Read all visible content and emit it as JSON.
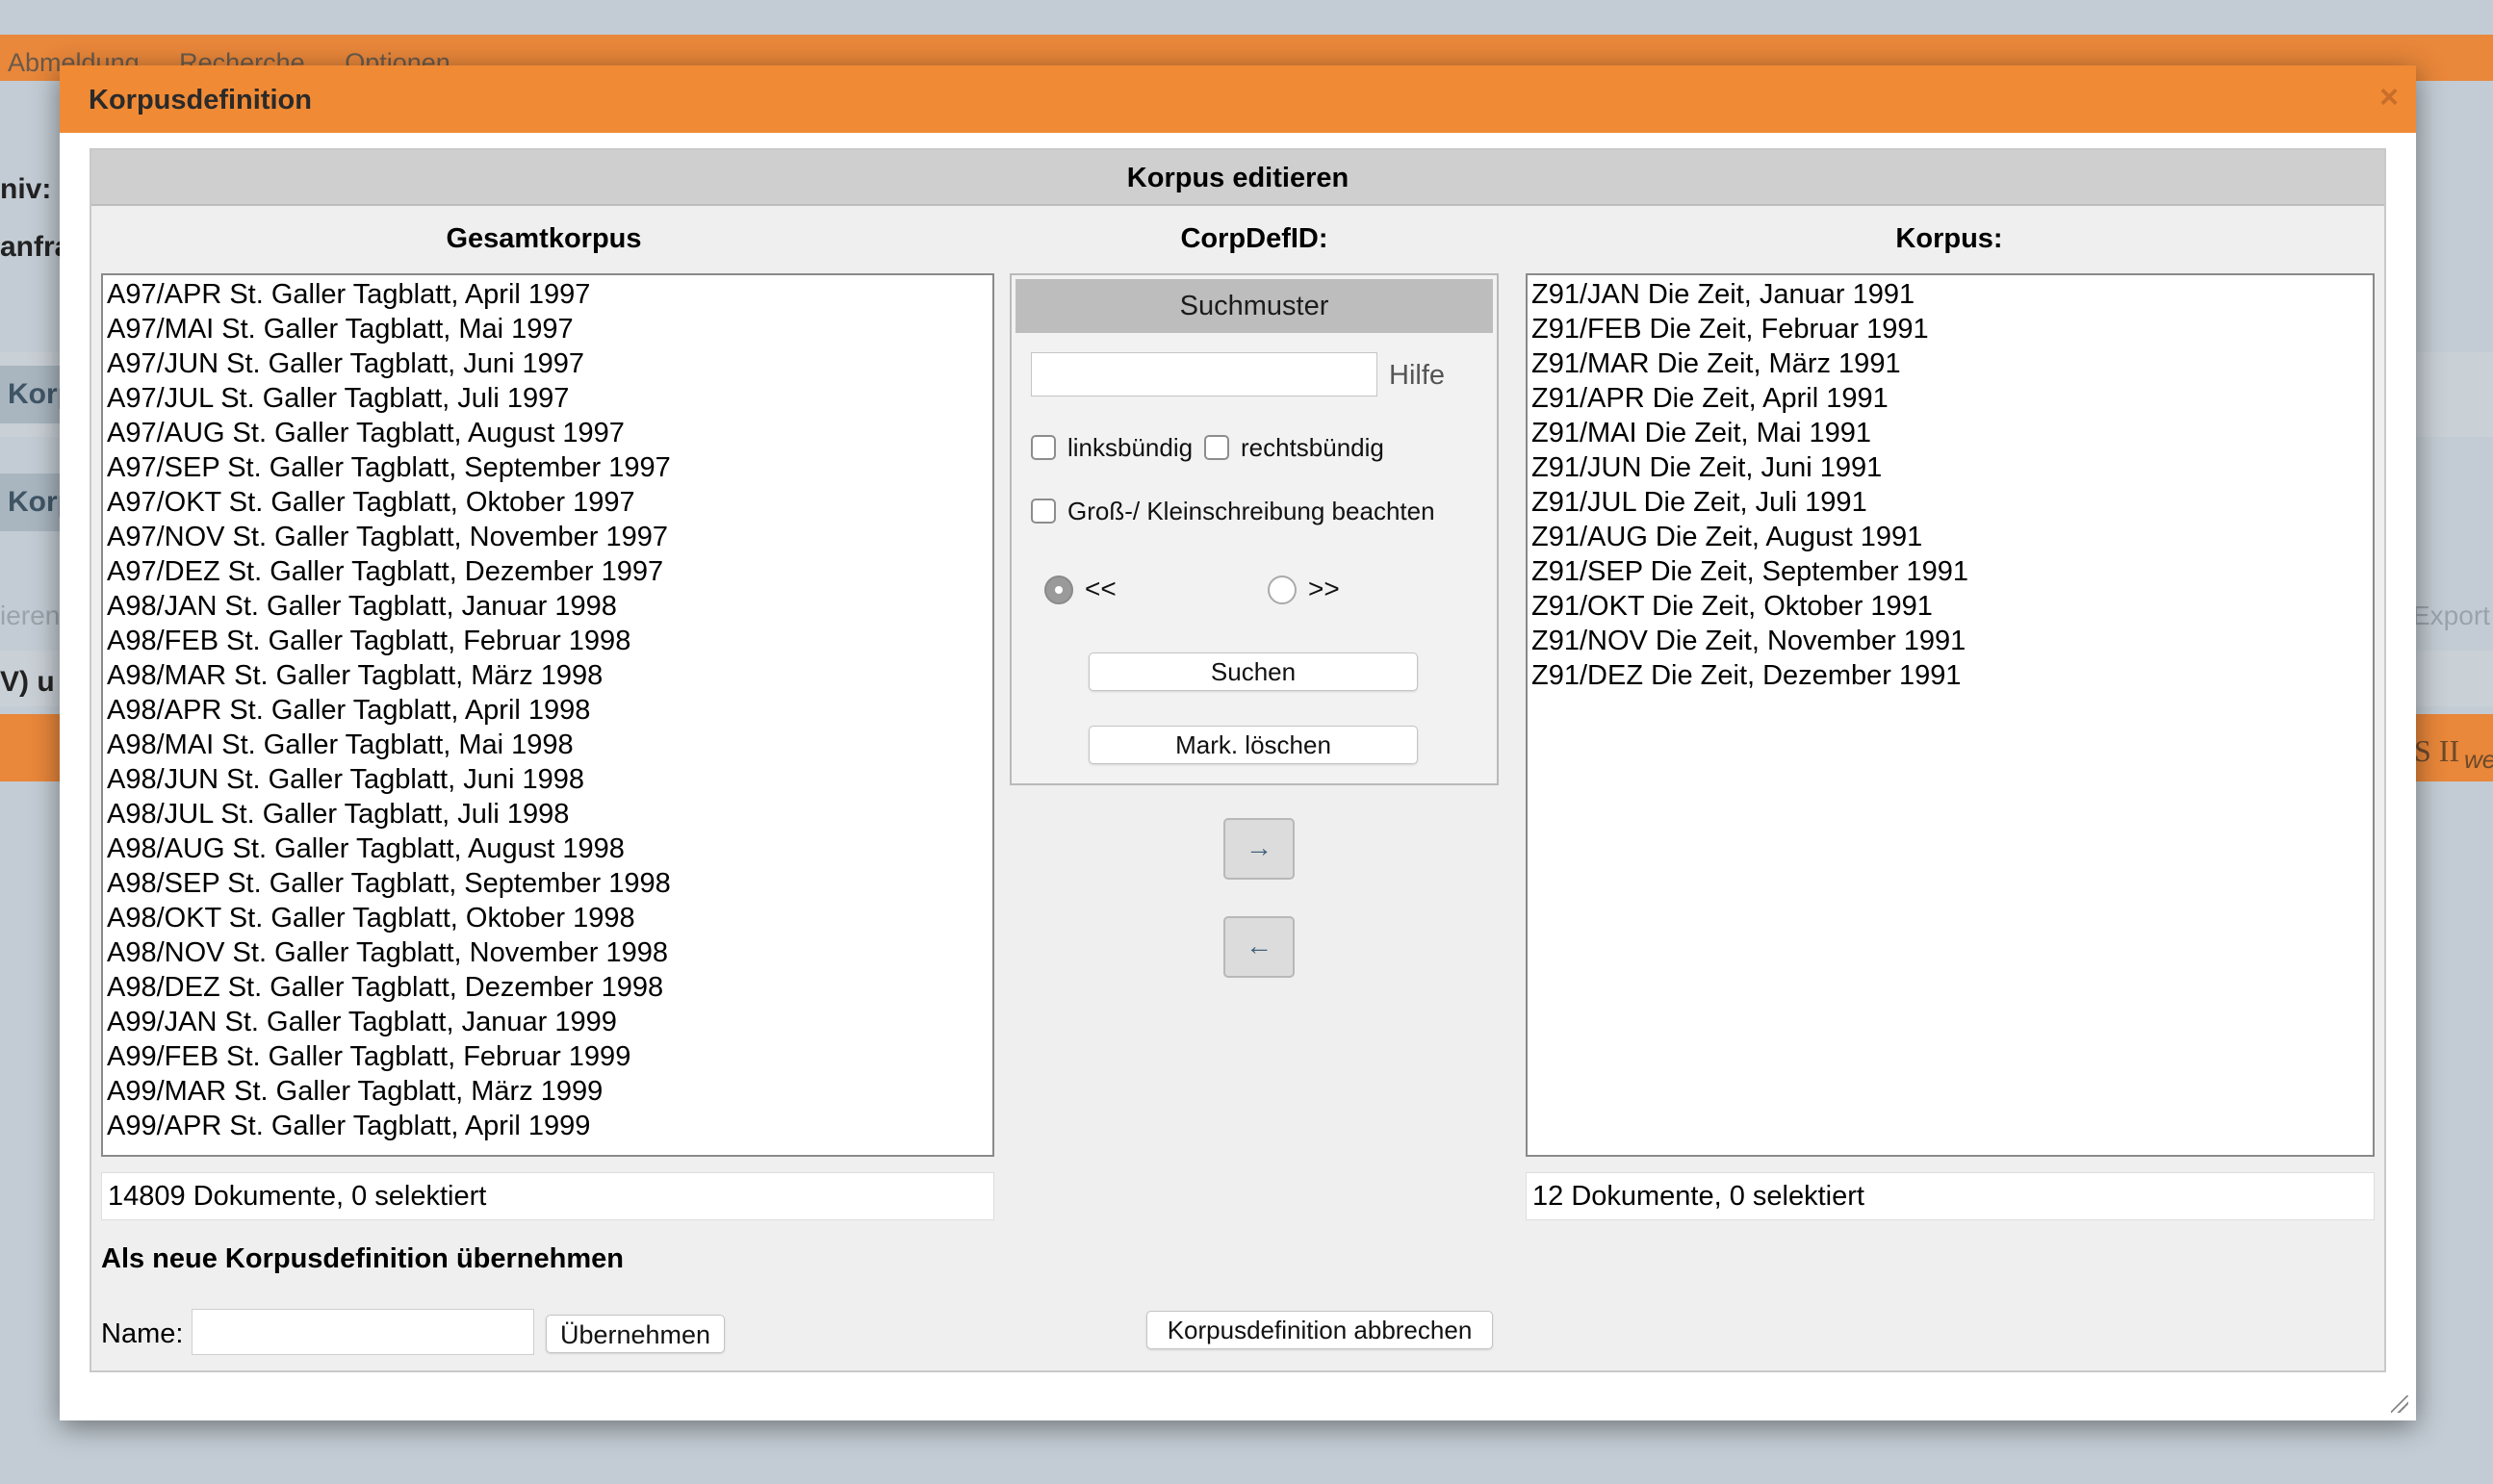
{
  "background": {
    "nav": [
      "Abmeldung",
      "Recherche",
      "Optionen"
    ],
    "labels": {
      "archiv": "niv:",
      "anfrage": "anfra",
      "korp_tab1": "Korp",
      "korp_tab2": "Korp",
      "ieren": "ieren",
      "v_und": "V) u",
      "export": "Export",
      "cosmas": "S II",
      "we": "we"
    }
  },
  "modal": {
    "title": "Korpusdefinition",
    "close": "×",
    "panel_title": "Korpus editieren",
    "left": {
      "title": "Gesamtkorpus",
      "items": [
        "A97/APR St. Galler Tagblatt, April 1997",
        "A97/MAI St. Galler Tagblatt, Mai 1997",
        "A97/JUN St. Galler Tagblatt, Juni 1997",
        "A97/JUL St. Galler Tagblatt, Juli 1997",
        "A97/AUG St. Galler Tagblatt, August 1997",
        "A97/SEP St. Galler Tagblatt, September 1997",
        "A97/OKT St. Galler Tagblatt, Oktober 1997",
        "A97/NOV St. Galler Tagblatt, November 1997",
        "A97/DEZ St. Galler Tagblatt, Dezember 1997",
        "A98/JAN St. Galler Tagblatt, Januar 1998",
        "A98/FEB St. Galler Tagblatt, Februar 1998",
        "A98/MAR St. Galler Tagblatt, März 1998",
        "A98/APR St. Galler Tagblatt, April 1998",
        "A98/MAI St. Galler Tagblatt, Mai 1998",
        "A98/JUN St. Galler Tagblatt, Juni 1998",
        "A98/JUL St. Galler Tagblatt, Juli 1998",
        "A98/AUG St. Galler Tagblatt, August 1998",
        "A98/SEP St. Galler Tagblatt, September 1998",
        "A98/OKT St. Galler Tagblatt, Oktober 1998",
        "A98/NOV St. Galler Tagblatt, November 1998",
        "A98/DEZ St. Galler Tagblatt, Dezember 1998",
        "A99/JAN St. Galler Tagblatt, Januar 1999",
        "A99/FEB St. Galler Tagblatt, Februar 1999",
        "A99/MAR St. Galler Tagblatt, März 1999",
        "A99/APR St. Galler Tagblatt, April 1999"
      ],
      "count": "14809 Dokumente, 0 selektiert"
    },
    "middle": {
      "title": "CorpDefID:",
      "search_header": "Suchmuster",
      "search_value": "",
      "help": "Hilfe",
      "left_aligned": "linksbündig",
      "right_aligned": "rechtsbündig",
      "case_sensitive": "Groß-/ Kleinschreibung beachten",
      "dir_left": "<<",
      "dir_right": ">>",
      "search_button": "Suchen",
      "clear_button": "Mark. löschen",
      "move_right": "→",
      "move_left": "←"
    },
    "right": {
      "title": "Korpus:",
      "items": [
        "Z91/JAN Die Zeit, Januar 1991",
        "Z91/FEB Die Zeit, Februar 1991",
        "Z91/MAR Die Zeit, März 1991",
        "Z91/APR Die Zeit, April 1991",
        "Z91/MAI Die Zeit, Mai 1991",
        "Z91/JUN Die Zeit, Juni 1991",
        "Z91/JUL Die Zeit, Juli 1991",
        "Z91/AUG Die Zeit, August 1991",
        "Z91/SEP Die Zeit, September 1991",
        "Z91/OKT Die Zeit, Oktober 1991",
        "Z91/NOV Die Zeit, November 1991",
        "Z91/DEZ Die Zeit, Dezember 1991"
      ],
      "count": "12 Dokumente, 0 selektiert"
    },
    "bottom": {
      "title": "Als neue Korpusdefinition übernehmen",
      "name_label": "Name:",
      "name_value": "",
      "apply_button": "Übernehmen",
      "cancel_button": "Korpusdefinition abbrechen"
    }
  },
  "colors": {
    "header_orange": "#f08a35",
    "panel_gray": "#efefef",
    "arrow_blue": "#44617a"
  }
}
